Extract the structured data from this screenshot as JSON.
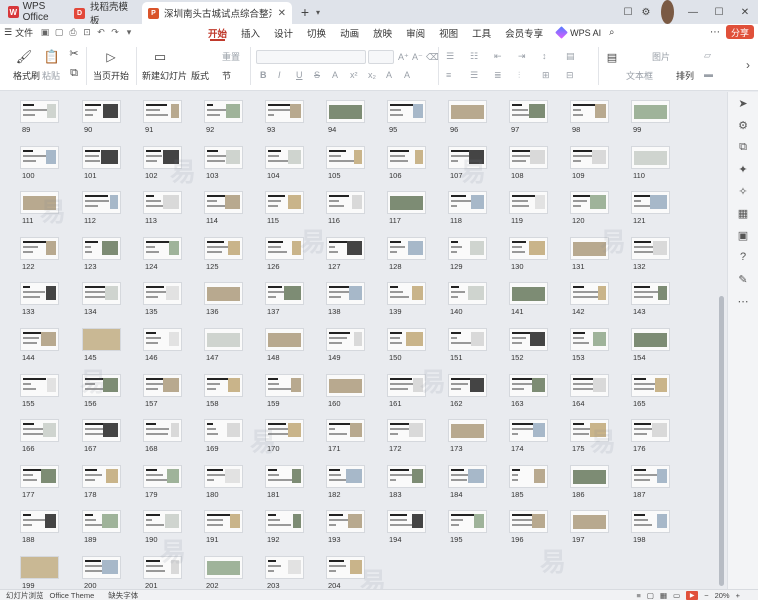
{
  "app": {
    "name": "WPS Office",
    "logo_glyph": "W"
  },
  "tabs": [
    {
      "label": "找稻壳模板",
      "badge": "D",
      "badge_color": "#e2483a"
    },
    {
      "label": "深圳南头古城试点综合整治规划",
      "badge": "P",
      "badge_color": "#d9542a"
    }
  ],
  "icons": {
    "new_tab": "+",
    "tab_menu": "▾",
    "window_menu": "☐",
    "settings": "⚙",
    "minimize": "—",
    "maximize": "☐",
    "close": "✕",
    "more": "⋯"
  },
  "menu": {
    "file_label": "文件",
    "items": [
      "开始",
      "插入",
      "设计",
      "切换",
      "动画",
      "放映",
      "审阅",
      "视图",
      "工具",
      "会员专享"
    ],
    "active": "开始",
    "wps_ai": "WPS AI",
    "share": "分享"
  },
  "ribbon": {
    "format_painter": "格式刷",
    "paste": "粘贴",
    "play_from_current": "当页开始",
    "new_slide": "新建幻灯片",
    "layout": "版式",
    "section": "节",
    "reset": "重置",
    "text_box": "文本框",
    "shape": "形状",
    "picture": "图片",
    "arrange": "排列",
    "format_glyphs": [
      "B",
      "I",
      "U",
      "S",
      "A",
      "x²",
      "x₂",
      "A",
      "A"
    ]
  },
  "slides": {
    "first": 89,
    "last": 204
  },
  "status": {
    "view": "幻灯片浏览",
    "theme": "Office Theme",
    "font_missing": "缺失字体",
    "zoom": "20%"
  },
  "watermark": "易"
}
